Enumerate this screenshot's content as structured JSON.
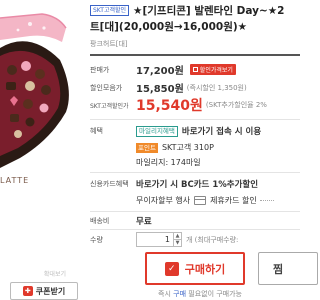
{
  "product": {
    "badge": "SKT고객할인",
    "title_line1": "★[기프티콘] 발렌타인 Day~★2",
    "title_line2": "트[대](20,000원→16,000원)★",
    "seller": "팡크허트[대]",
    "image_text": "LATTE",
    "image_caption": "확대보기"
  },
  "prices": {
    "sale_label": "판매가",
    "sale_value": "17,200원",
    "sale_button": "할인가격보기",
    "discount_label": "할인모음가",
    "discount_value": "15,850원",
    "discount_sub": "(즉시할인 1,350원)",
    "skt_label": "SKT고객할인가",
    "skt_value": "15,540원",
    "skt_sub": "(SKT추가할인율 2%"
  },
  "benefits": {
    "label": "혜택",
    "tag1": "마일리지혜택",
    "text1": "바로가기 접속 시 이용",
    "tag2": "포인트",
    "text2": "SKT고객 310P",
    "text3": "마일리지: 174마일"
  },
  "card": {
    "label": "신용카드혜택",
    "text1": "바로가기 시 BC카드 1%추가할인",
    "text2": "무이자할부 행사",
    "text3": "제휴카드 할인"
  },
  "shipping": {
    "label": "배송비",
    "value": "무료"
  },
  "quantity": {
    "label": "수량",
    "value": "1",
    "unit": "개 (최대구매수량:",
    "up": "▲",
    "down": "▼"
  },
  "actions": {
    "coupon": "쿠폰받기",
    "buy": "구매하기",
    "wish": "찜",
    "pay_note_prefix": "즉시",
    "pay_note_highlight": "구매",
    "pay_note_suffix": "필요없이 구매가능"
  },
  "colors": {
    "accent": "#e0392b",
    "skt_blue": "#3a63c8",
    "mint": "#2a9b8e",
    "orange": "#f08a2a"
  }
}
